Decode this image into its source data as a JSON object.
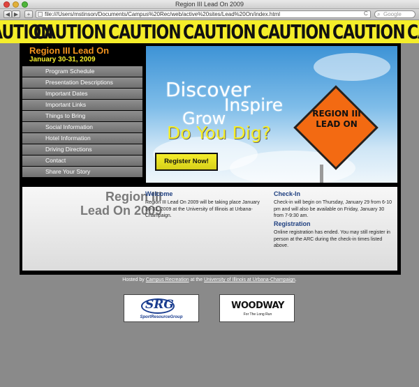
{
  "window": {
    "title": "Region III Lead On 2009"
  },
  "browser": {
    "url": "file:///Users/mstinson/Documents/Campus%20Rec/web/active%20sites/Lead%20On/index.html",
    "search_placeholder": "Google",
    "back_glyph": "◀",
    "forward_glyph": "▶",
    "add_glyph": "+",
    "reload_glyph": "C"
  },
  "banner": {
    "word": "CAUTION"
  },
  "site": {
    "title": "Region III Lead On",
    "date": "January 30-31, 2009"
  },
  "nav": [
    "Program Schedule",
    "Presentation Descriptions",
    "Important Dates",
    "Important Links",
    "Things to Bring",
    "Social Information",
    "Hotel Information",
    "Driving Directions",
    "Contact",
    "Share Your Story"
  ],
  "hero": {
    "word1": "Discover",
    "word2": "Inspire",
    "word3": "Grow",
    "word4": "Do You Dig?",
    "sign_line1": "REGION III",
    "sign_line2": "LEAD ON",
    "register_label": "Register Now!"
  },
  "content": {
    "title_line1": "Region III",
    "title_line2": "Lead On 2009",
    "welcome_head": "Welcome",
    "welcome_text": "Region III Lead On 2009 will be taking place January 30-31, 2009 at the University of Illinois at Urbana-Champaign.",
    "checkin_head": "Check-In",
    "checkin_text": "Check-in will begin on Thursday, January 29 from 6-10 pm and will also be available on Friday, January 30 from 7-9:30 am.",
    "registration_head": "Registration",
    "registration_text": "Online registration has ended. You may still register in person at the ARC during the check-in times listed above."
  },
  "footer": {
    "prefix": "Hosted by",
    "host_link": "Campus Recreation",
    "middle": "at the",
    "univ_link": "University of Illinois at Urbana-Champaign",
    "suffix": "."
  },
  "sponsors": {
    "src_mark": "SRG",
    "src_name": "SportResourceGroup",
    "woodway_mark": "WOODWAY",
    "woodway_tag": "For The Long Run"
  },
  "colors": {
    "tape_yellow": "#f5ee2a",
    "title_orange": "#f4941e",
    "heading_blue": "#1e3f80"
  }
}
